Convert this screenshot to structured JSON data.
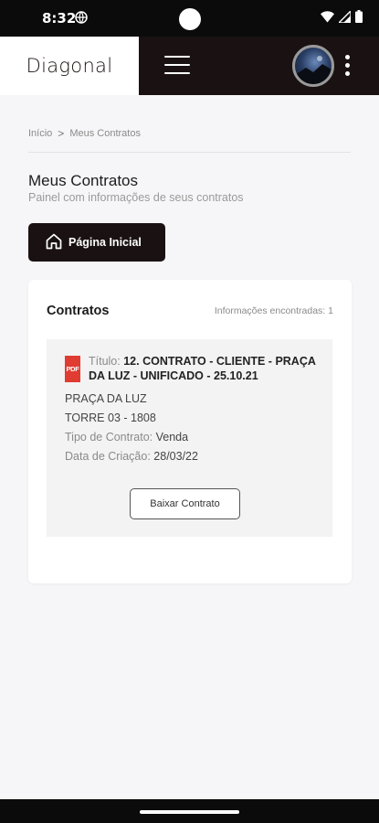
{
  "status_bar": {
    "time": "8:32"
  },
  "header": {
    "logo": "Diagonal"
  },
  "breadcrumb": {
    "home": "Início",
    "separator": ">",
    "current": "Meus Contratos"
  },
  "page": {
    "title": "Meus Contratos",
    "subtitle": "Painel com informações de seus contratos",
    "home_button": "Página Inicial"
  },
  "contracts": {
    "title": "Contratos",
    "count_label": "Informações encontradas: 1",
    "items": [
      {
        "icon_label": "PDF",
        "title_label": "Título:",
        "title_value": "12. CONTRATO - CLIENTE - PRAÇA DA LUZ - UNIFICADO - 25.10.21",
        "location": "PRAÇA DA LUZ",
        "unit": "TORRE 03 - 1808",
        "type_label": "Tipo de Contrato:",
        "type_value": "Venda",
        "date_label": "Data de Criação:",
        "date_value": "28/03/22",
        "download_label": "Baixar Contrato"
      }
    ]
  },
  "colors": {
    "brand_dark": "#1a1212",
    "pdf_red": "#e03c31",
    "background": "#f6f6f8"
  }
}
